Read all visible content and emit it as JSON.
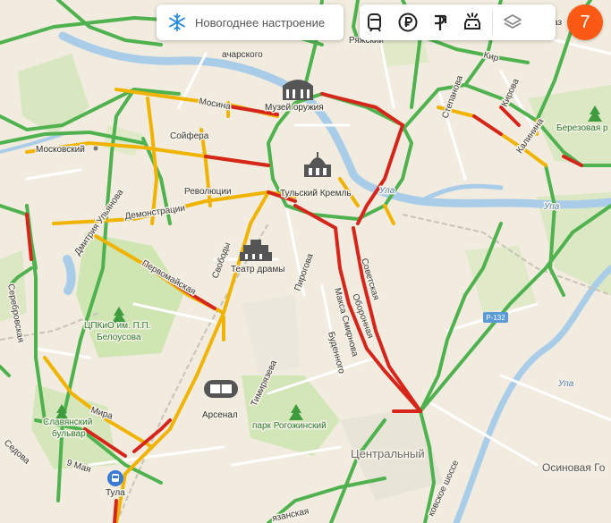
{
  "toolbar": {
    "mood_label": "Новогоднее настроение",
    "mood_icon": "snowflake-icon",
    "tools": [
      {
        "name": "transport-icon",
        "title": ""
      },
      {
        "name": "ruble-icon",
        "title": ""
      },
      {
        "name": "parking-icon",
        "title": ""
      },
      {
        "name": "road-events-icon",
        "title": ""
      },
      {
        "name": "layers-icon",
        "title": ""
      }
    ]
  },
  "traffic_score": "7",
  "colors": {
    "traffic_free": "#4fb24f",
    "traffic_moderate": "#f0b400",
    "traffic_heavy": "#d6261c",
    "river": "#a9cde8",
    "park": "#cfe5b2",
    "score_badge": "#fc5a14"
  },
  "map": {
    "streets": {
      "uchar": "ачарского",
      "ryazh": "Ряжский",
      "mosina": "Мосина",
      "soyfera": "Сойфера",
      "revol": "Революции",
      "demonstr": "Демонстрации",
      "ulyanova": "Дмитрия Ульянова",
      "pervomay": "Первомайская",
      "svobody": "Свободы",
      "pirogova": "Пирогова",
      "serebr": "Серебровская",
      "sovetsk": "Советская",
      "oboronnaya": "Оборонная",
      "makszmir": "Макса Смирнова",
      "budenn": "Буденного",
      "timiryaz": "Тимирязева",
      "mira": "Мира",
      "sedova": "Седова",
      "may9": "9 Мая",
      "stepanova": "Степанова",
      "kirova": "Кирова",
      "kalinina": "Калинина",
      "kirpichn": "Кир",
      "shosse": "ковское шоссе",
      "ryazansk": "язанская",
      "ulitsa": "Ула",
      "ulitsa2": "Упа",
      "ulitsa3": "Упа"
    },
    "pois": {
      "moskovsky": "Московский",
      "muzey": "Музей оружия",
      "kreml": "Тульский Кремль",
      "teatr": "Театр драмы",
      "cpkio": "ЦПКиО им. П.П.",
      "belousova": "Белоусова",
      "slav1": "Славянский",
      "slav2": "бульвар",
      "arsenal": "Арсенал",
      "rogozh": "парк Рогожинский",
      "tula": "Тула",
      "berez": "Березовая р",
      "tsentr": "Центральный",
      "osinovaya": "Осиновая Го",
      "r132": "Р-132",
      "kaz": "аз"
    }
  }
}
